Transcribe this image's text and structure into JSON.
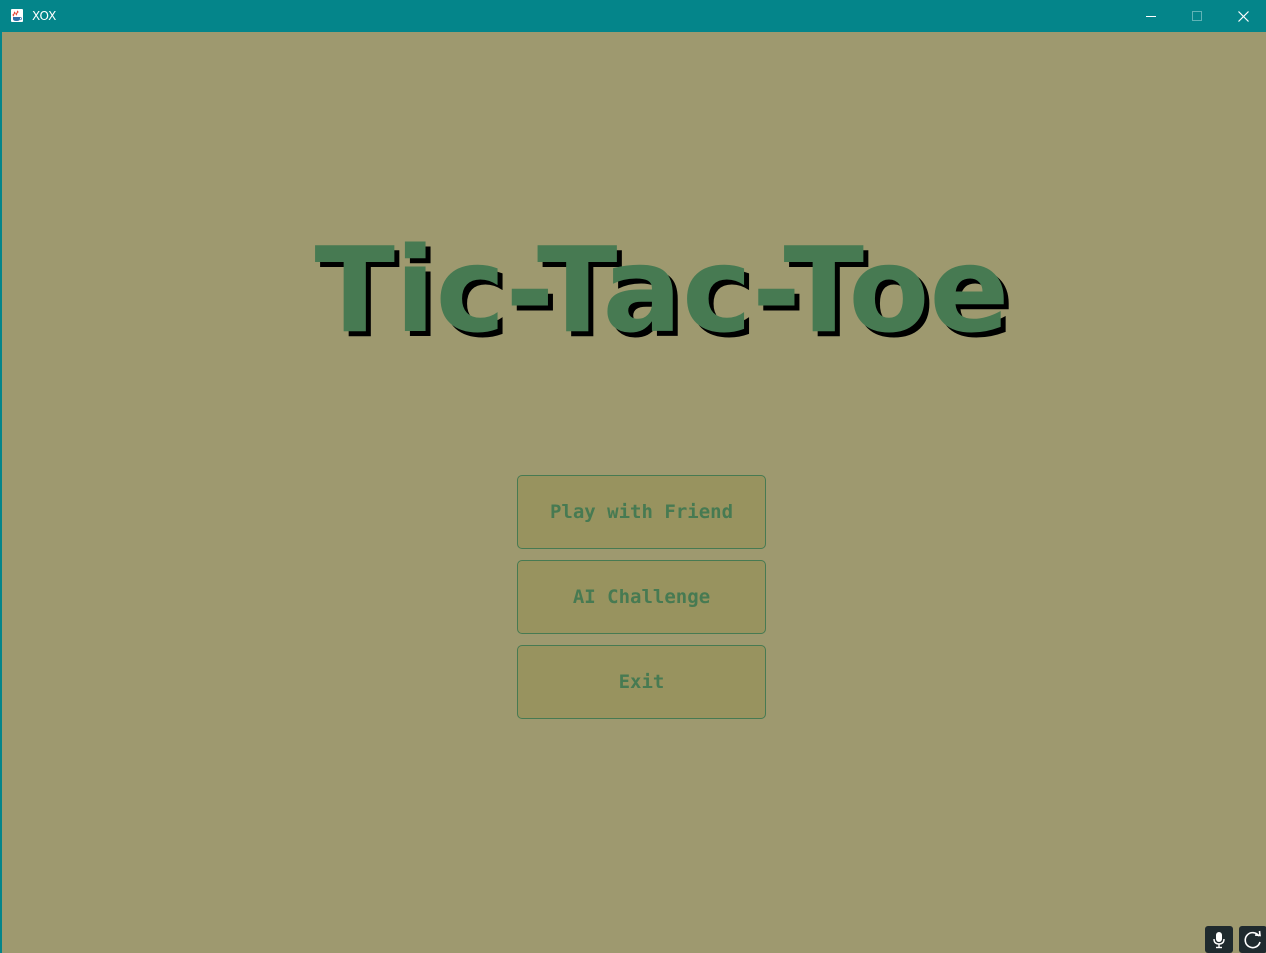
{
  "window": {
    "title": "XOX"
  },
  "icons": {
    "app": "java-cup-icon",
    "minimize": "minimize-icon",
    "maximize": "maximize-icon",
    "close": "close-icon",
    "microphone": "microphone-icon",
    "refresh": "refresh-icon"
  },
  "main": {
    "title": "Tic-Tac-Toe",
    "buttons": {
      "play_friend": "Play with Friend",
      "ai_challenge": "AI Challenge",
      "exit": "Exit"
    }
  },
  "colors": {
    "titlebar": "#04858a",
    "background": "#9e996f",
    "accent_green": "#477a52",
    "button_fill": "#98935f"
  }
}
